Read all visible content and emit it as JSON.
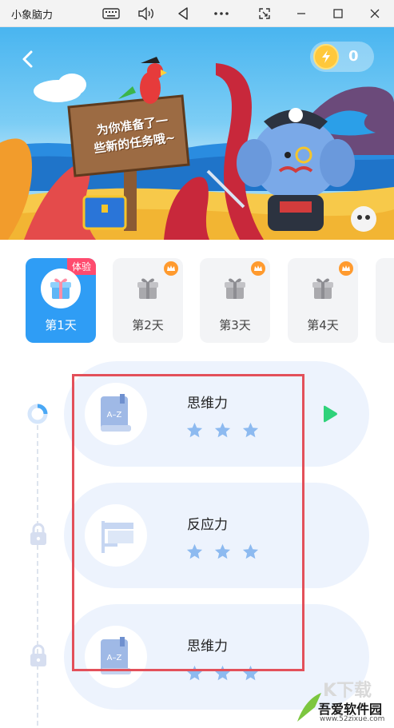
{
  "window": {
    "title": "小象脑力",
    "controls": [
      "keyboard-icon",
      "volume-icon",
      "back-triangle-icon",
      "more-icon",
      "screenshot-icon",
      "minimize-icon",
      "maximize-icon",
      "close-icon"
    ]
  },
  "banner": {
    "sign_line1": "为你准备了一",
    "sign_line2": "些新的任务哦~",
    "coin_count": "0"
  },
  "days": [
    {
      "label": "第1天",
      "badge": "体验",
      "active": true
    },
    {
      "label": "第2天",
      "badge": "crown-icon",
      "active": false
    },
    {
      "label": "第3天",
      "badge": "crown-icon",
      "active": false
    },
    {
      "label": "第4天",
      "badge": "crown-icon",
      "active": false
    }
  ],
  "tasks": [
    {
      "title": "思维力",
      "icon": "book-az-icon",
      "stars": 3,
      "status": "in-progress"
    },
    {
      "title": "反应力",
      "icon": "flag-icon",
      "stars": 3,
      "status": "locked"
    },
    {
      "title": "思维力",
      "icon": "book-az-icon",
      "stars": 3,
      "status": "locked"
    }
  ],
  "watermark": {
    "text": "吾爱软件园",
    "url": "www.52zixue.com"
  },
  "colors": {
    "accent": "#2f9df5",
    "card_bg": "#edf3fd",
    "star": "#8dbaf0",
    "play": "#2fd27a",
    "highlight": "#e3505a",
    "trial_badge": "#ff4b6e"
  }
}
